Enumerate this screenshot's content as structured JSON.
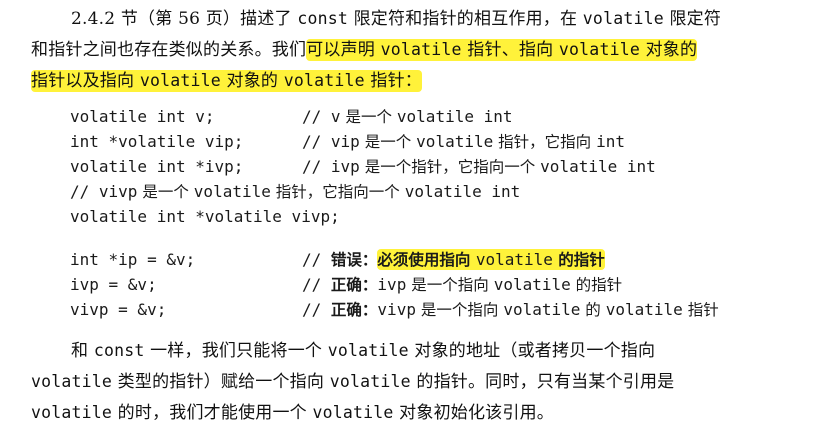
{
  "intro": {
    "line1": {
      "a": "2.4.2 节（第 56 页）描述了 ",
      "b": "const",
      "c": " 限定符和指针的相互作用，在 ",
      "d": "volatile",
      "e": " 限定符"
    },
    "line2": {
      "a": "和指针之间也存在类似的关系。我们",
      "hl_a": "可以声明 ",
      "hl_b": "volatile",
      "hl_c": " 指针、指向 ",
      "hl_d": "volatile",
      "hl_e": " 对象的"
    },
    "line3": {
      "hl_a": "指针以及指向 ",
      "hl_b": "volatile",
      "hl_c": " 对象的 ",
      "hl_d": "volatile",
      "hl_e": " 指针："
    }
  },
  "code": {
    "decls": [
      {
        "stmt": "volatile int v;",
        "comment_prefix": "// ",
        "comment_a": "v",
        "comment_zh": " 是一个 ",
        "comment_b": "volatile int",
        "comment_zh2": "",
        "comment_c": ""
      },
      {
        "stmt": "int *volatile vip;",
        "comment_prefix": "// ",
        "comment_a": "vip",
        "comment_zh": " 是一个 ",
        "comment_b": "volatile",
        "comment_zh2": " 指针，它指向 ",
        "comment_c": "int"
      },
      {
        "stmt": "volatile int *ivp;",
        "comment_prefix": "// ",
        "comment_a": "ivp",
        "comment_zh": " 是一个指针，它指向一个 ",
        "comment_b": "volatile int",
        "comment_zh2": "",
        "comment_c": ""
      }
    ],
    "vivp_comment": {
      "prefix": "// ",
      "a": "vivp",
      "zh": " 是一个 ",
      "b": "volatile",
      "zh2": " 指针，它指向一个 ",
      "c": "volatile int"
    },
    "vivp_decl": "volatile int *volatile vivp;",
    "assigns": [
      {
        "stmt": "int *ip = &v;",
        "prefix": "// ",
        "label": "错误：",
        "hl_a": "必须使用指向 ",
        "hl_b": "volatile",
        "hl_c": " 的指针"
      },
      {
        "stmt": "ivp = &v;",
        "prefix": "// ",
        "label": "正确：",
        "a": "ivp",
        "zh": " 是一个指向 ",
        "b": "volatile",
        "zh2": " 的指针"
      },
      {
        "stmt": "vivp = &v;",
        "prefix": "// ",
        "label": "正确：",
        "a": "vivp",
        "zh": " 是一个指向 ",
        "b": "volatile",
        "zh2": " 的 ",
        "c": "volatile",
        "zh3": " 指针"
      }
    ]
  },
  "outro": {
    "line1": {
      "a": "和 ",
      "b": "const",
      "c": " 一样，我们只能将一个 ",
      "d": "volatile",
      "e": " 对象的地址（或者拷贝一个指向"
    },
    "line2": {
      "a": "volatile",
      "b": " 类型的指针）赋给一个指向 ",
      "c": "volatile",
      "d": " 的指针。同时，只有当某个引用是"
    },
    "line3": {
      "a": "volatile",
      "b": " 的时，我们才能使用一个 ",
      "c": "volatile",
      "d": " 对象初始化该引用。"
    }
  },
  "colors": {
    "highlight": "#fff23a",
    "text": "#111111"
  }
}
